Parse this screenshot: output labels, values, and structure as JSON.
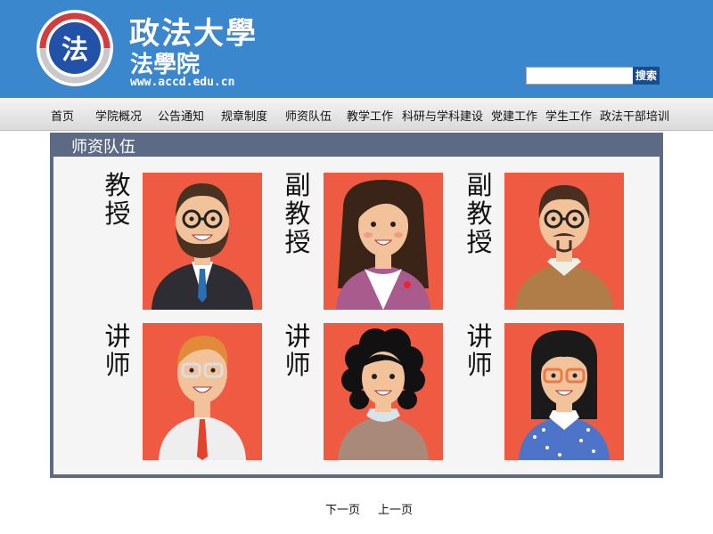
{
  "header": {
    "school_name": "政法大學",
    "department": "法學院",
    "url": "www.accd.edu.cn",
    "logo_char": "法",
    "search_placeholder": "",
    "search_button": "搜索"
  },
  "nav": {
    "items": [
      "首页",
      "学院概况",
      "公告通知",
      "规章制度",
      "师资队伍",
      "教学工作",
      "科研与学科建设",
      "党建工作",
      "学生工作",
      "政法干部培训"
    ]
  },
  "panel": {
    "title": "师资队伍",
    "faculty": [
      {
        "rank": "教授",
        "avatar": "bearded-man-glasses-suit-icon"
      },
      {
        "rank": "副教授",
        "avatar": "long-haired-woman-icon"
      },
      {
        "rank": "副教授",
        "avatar": "mustached-man-glasses-icon"
      },
      {
        "rank": "讲师",
        "avatar": "young-man-glasses-tie-icon"
      },
      {
        "rank": "讲师",
        "avatar": "curly-haired-woman-icon"
      },
      {
        "rank": "讲师",
        "avatar": "woman-glasses-polka-dot-icon"
      }
    ]
  },
  "pager": {
    "next": "下一页",
    "prev": "上一页"
  },
  "colors": {
    "header_bg": "#3a87cd",
    "panel_frame": "#5c6a85",
    "portrait_bg": "#ee5b42",
    "search_button_bg": "#1a4c8c"
  }
}
